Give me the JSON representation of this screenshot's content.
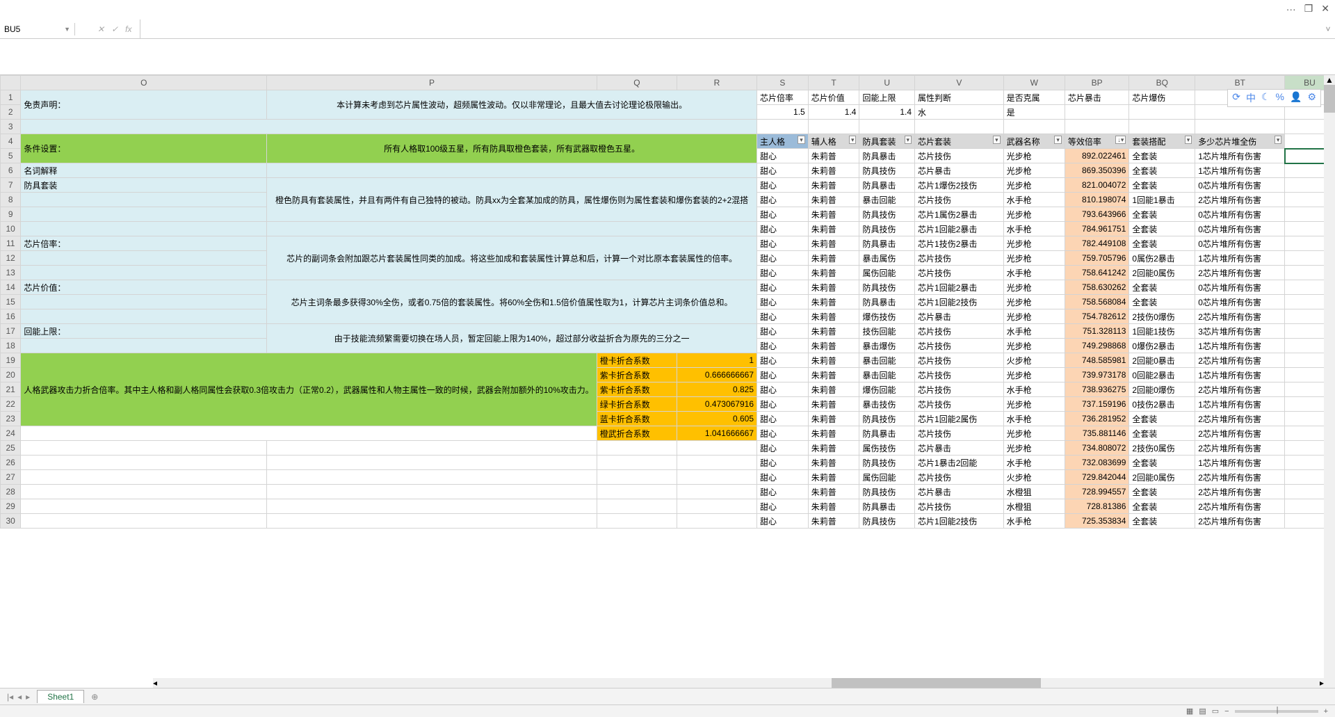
{
  "window": {
    "more": "···",
    "maximize": "❐",
    "close": "✕"
  },
  "nameBox": "BU5",
  "formulaTools": {
    "cancel": "✕",
    "confirm": "✓",
    "fx": "fx"
  },
  "toolbarIcons": [
    "⟳",
    "中",
    "☾",
    "%",
    "👤",
    "⚙"
  ],
  "columns": [
    "O",
    "P",
    "Q",
    "R",
    "S",
    "T",
    "U",
    "V",
    "W",
    "BP",
    "BQ",
    "BT",
    "BU"
  ],
  "rowNums": [
    1,
    2,
    3,
    4,
    5,
    6,
    7,
    8,
    9,
    10,
    11,
    12,
    13,
    14,
    15,
    16,
    17,
    18,
    19,
    20,
    21,
    22,
    23,
    24,
    25,
    26,
    27,
    28,
    29,
    30
  ],
  "disclaimer": {
    "label": "免责声明：",
    "text": "本计算未考虑到芯片属性波动，超频属性波动。仅以非常理论，且最大值去讨论理论极限输出。"
  },
  "condition": {
    "label": "条件设置：",
    "text": "所有人格取100级五星，所有防具取橙色套装，所有武器取橙色五星。"
  },
  "glossary": {
    "h": "名词解释",
    "armor": "防具套装",
    "armor_def": "橙色防具有套装属性，并且有两件有自己独特的被动。防具xx为全套某加成的防具，属性爆伤则为属性套装和爆伤套装的2+2混搭",
    "chipMult": "芯片倍率：",
    "chipMult_def": "芯片的副词条会附加跟芯片套装属性同类的加成。将这些加成和套装属性计算总和后，计算一个对比原本套装属性的倍率。",
    "chipVal": "芯片价值：",
    "chipVal_def": "芯片主词条最多获得30%全伤，或者0.75倍的套装属性。将60%全伤和1.5倍价值属性取为1，计算芯片主词条价值总和。",
    "energy": "回能上限：",
    "energy_def": "由于技能流频繁需要切换在场人员，暂定回能上限为140%，超过部分收益折合为原先的三分之一"
  },
  "greenBox": "人格武器攻击力折合倍率。其中主人格和副人格同属性会获取0.3倍攻击力（正常0.2），武器属性和人物主属性一致的时候，武器会附加额外的10%攻击力。",
  "coeff": [
    {
      "name": "橙卡折合系数",
      "v": "1"
    },
    {
      "name": "紫卡折合系数",
      "v": "0.666666667"
    },
    {
      "name": "紫卡折合系数",
      "v": "0.825"
    },
    {
      "name": "绿卡折合系数",
      "v": "0.473067916"
    },
    {
      "name": "蓝卡折合系数",
      "v": "0.605"
    },
    {
      "name": "橙武折合系数",
      "v": "1.041666667"
    }
  ],
  "topHeaders": {
    "S": "芯片倍率",
    "T": "芯片价值",
    "U": "回能上限",
    "V": "属性判断",
    "W": "是否克属",
    "BP": "芯片暴击",
    "BQ": "芯片爆伤"
  },
  "topVals": {
    "S": "1.5",
    "T": "1.4",
    "U": "1.4",
    "V": "水",
    "W": "是"
  },
  "filterHeaders": {
    "S": "主人格",
    "T": "辅人格",
    "U": "防具套装",
    "V": "芯片套装",
    "W": "武器名称",
    "BP": "等效倍率",
    "BQ": "套装搭配",
    "BT": "多少芯片堆全伤"
  },
  "chart_data": {
    "type": "table",
    "columns": [
      "主人格",
      "辅人格",
      "防具套装",
      "芯片套装",
      "武器名称",
      "等效倍率",
      "套装搭配",
      "多少芯片堆全伤"
    ],
    "rows": [
      [
        "甜心",
        "朱莉普",
        "防具暴击",
        "芯片技伤",
        "光步枪",
        "892.022461",
        "全套装",
        "1芯片堆所有伤害"
      ],
      [
        "甜心",
        "朱莉普",
        "防具技伤",
        "芯片暴击",
        "光步枪",
        "869.350396",
        "全套装",
        "1芯片堆所有伤害"
      ],
      [
        "甜心",
        "朱莉普",
        "防具暴击",
        "芯片1爆伤2技伤",
        "光步枪",
        "821.004072",
        "全套装",
        "0芯片堆所有伤害"
      ],
      [
        "甜心",
        "朱莉普",
        "暴击回能",
        "芯片技伤",
        "水手枪",
        "810.198074",
        "1回能1暴击",
        "2芯片堆所有伤害"
      ],
      [
        "甜心",
        "朱莉普",
        "防具技伤",
        "芯片1属伤2暴击",
        "光步枪",
        "793.643966",
        "全套装",
        "0芯片堆所有伤害"
      ],
      [
        "甜心",
        "朱莉普",
        "防具技伤",
        "芯片1回能2暴击",
        "水手枪",
        "784.961751",
        "全套装",
        "0芯片堆所有伤害"
      ],
      [
        "甜心",
        "朱莉普",
        "防具暴击",
        "芯片1技伤2暴击",
        "光步枪",
        "782.449108",
        "全套装",
        "0芯片堆所有伤害"
      ],
      [
        "甜心",
        "朱莉普",
        "暴击属伤",
        "芯片技伤",
        "光步枪",
        "759.705796",
        "0属伤2暴击",
        "1芯片堆所有伤害"
      ],
      [
        "甜心",
        "朱莉普",
        "属伤回能",
        "芯片技伤",
        "水手枪",
        "758.641242",
        "2回能0属伤",
        "2芯片堆所有伤害"
      ],
      [
        "甜心",
        "朱莉普",
        "防具技伤",
        "芯片1回能2暴击",
        "光步枪",
        "758.630262",
        "全套装",
        "0芯片堆所有伤害"
      ],
      [
        "甜心",
        "朱莉普",
        "防具暴击",
        "芯片1回能2技伤",
        "光步枪",
        "758.568084",
        "全套装",
        "0芯片堆所有伤害"
      ],
      [
        "甜心",
        "朱莉普",
        "爆伤技伤",
        "芯片暴击",
        "光步枪",
        "754.782612",
        "2技伤0爆伤",
        "2芯片堆所有伤害"
      ],
      [
        "甜心",
        "朱莉普",
        "技伤回能",
        "芯片技伤",
        "水手枪",
        "751.328113",
        "1回能1技伤",
        "3芯片堆所有伤害"
      ],
      [
        "甜心",
        "朱莉普",
        "暴击爆伤",
        "芯片技伤",
        "光步枪",
        "749.298868",
        "0爆伤2暴击",
        "1芯片堆所有伤害"
      ],
      [
        "甜心",
        "朱莉普",
        "暴击回能",
        "芯片技伤",
        "火步枪",
        "748.585981",
        "2回能0暴击",
        "2芯片堆所有伤害"
      ],
      [
        "甜心",
        "朱莉普",
        "暴击回能",
        "芯片技伤",
        "光步枪",
        "739.973178",
        "0回能2暴击",
        "1芯片堆所有伤害"
      ],
      [
        "甜心",
        "朱莉普",
        "爆伤回能",
        "芯片技伤",
        "水手枪",
        "738.936275",
        "2回能0爆伤",
        "2芯片堆所有伤害"
      ],
      [
        "甜心",
        "朱莉普",
        "暴击技伤",
        "芯片技伤",
        "光步枪",
        "737.159196",
        "0技伤2暴击",
        "1芯片堆所有伤害"
      ],
      [
        "甜心",
        "朱莉普",
        "防具技伤",
        "芯片1回能2属伤",
        "水手枪",
        "736.281952",
        "全套装",
        "2芯片堆所有伤害"
      ],
      [
        "甜心",
        "朱莉普",
        "防具暴击",
        "芯片技伤",
        "光步枪",
        "735.881146",
        "全套装",
        "2芯片堆所有伤害"
      ],
      [
        "甜心",
        "朱莉普",
        "属伤技伤",
        "芯片暴击",
        "光步枪",
        "734.808072",
        "2技伤0属伤",
        "2芯片堆所有伤害"
      ],
      [
        "甜心",
        "朱莉普",
        "防具技伤",
        "芯片1暴击2回能",
        "水手枪",
        "732.083699",
        "全套装",
        "1芯片堆所有伤害"
      ],
      [
        "甜心",
        "朱莉普",
        "属伤回能",
        "芯片技伤",
        "火步枪",
        "729.842044",
        "2回能0属伤",
        "2芯片堆所有伤害"
      ],
      [
        "甜心",
        "朱莉普",
        "防具技伤",
        "芯片暴击",
        "水橙狙",
        "728.994557",
        "全套装",
        "2芯片堆所有伤害"
      ],
      [
        "甜心",
        "朱莉普",
        "防具暴击",
        "芯片技伤",
        "水橙狙",
        "728.81386",
        "全套装",
        "2芯片堆所有伤害"
      ],
      [
        "甜心",
        "朱莉普",
        "防具技伤",
        "芯片1回能2技伤",
        "水手枪",
        "725.353834",
        "全套装",
        "2芯片堆所有伤害"
      ]
    ]
  },
  "sheetTab": "Sheet1"
}
